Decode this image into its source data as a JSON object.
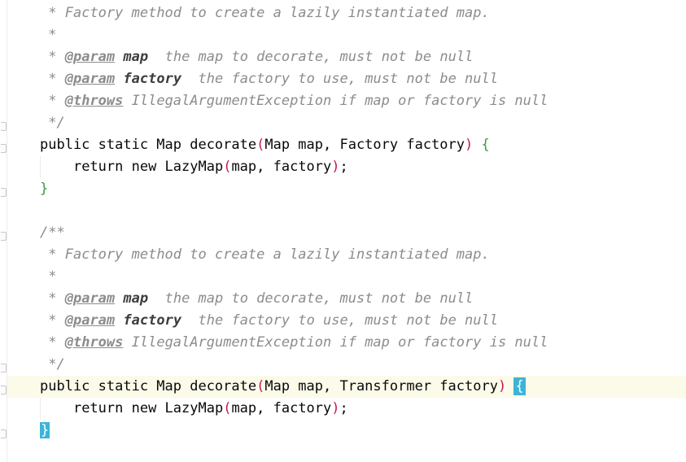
{
  "editor": {
    "lines": [
      {
        "id": "l1",
        "indent": " ",
        "parts": [
          {
            "t": "* ",
            "c": "doc"
          },
          {
            "t": "Factory method to create a lazily instantiated map.",
            "c": "doc"
          }
        ]
      },
      {
        "id": "l2",
        "indent": " ",
        "parts": [
          {
            "t": "*",
            "c": "doc"
          }
        ]
      },
      {
        "id": "l3",
        "indent": " ",
        "parts": [
          {
            "t": "* ",
            "c": "doc"
          },
          {
            "t": "@param",
            "c": "doc-tag"
          },
          {
            "t": " ",
            "c": "doc"
          },
          {
            "t": "map",
            "c": "doc-param"
          },
          {
            "t": "  the map to decorate, must not be null",
            "c": "doc"
          }
        ]
      },
      {
        "id": "l4",
        "indent": " ",
        "parts": [
          {
            "t": "* ",
            "c": "doc"
          },
          {
            "t": "@param",
            "c": "doc-tag"
          },
          {
            "t": " ",
            "c": "doc"
          },
          {
            "t": "factory",
            "c": "doc-param"
          },
          {
            "t": "  the factory to use, must not be null",
            "c": "doc"
          }
        ]
      },
      {
        "id": "l5",
        "indent": " ",
        "parts": [
          {
            "t": "* ",
            "c": "doc"
          },
          {
            "t": "@throws",
            "c": "doc-tag"
          },
          {
            "t": " IllegalArgumentException if map or factory is null",
            "c": "doc"
          }
        ]
      },
      {
        "id": "l6",
        "indent": " ",
        "parts": [
          {
            "t": "*/",
            "c": "doc"
          }
        ]
      },
      {
        "id": "l7",
        "indent": "",
        "parts": [
          {
            "t": "public static Map decorate",
            "c": "plain"
          },
          {
            "t": "(",
            "c": "paren-pink"
          },
          {
            "t": "Map map, Factory factory",
            "c": "plain"
          },
          {
            "t": ")",
            "c": "paren-pink"
          },
          {
            "t": " ",
            "c": "plain"
          },
          {
            "t": "{",
            "c": "brace-green"
          }
        ]
      },
      {
        "id": "l8",
        "indent": "    ",
        "parts": [
          {
            "t": "return new LazyMap",
            "c": "plain"
          },
          {
            "t": "(",
            "c": "paren-pink"
          },
          {
            "t": "map, factory",
            "c": "plain"
          },
          {
            "t": ")",
            "c": "paren-pink"
          },
          {
            "t": ";",
            "c": "plain"
          }
        ]
      },
      {
        "id": "l9",
        "indent": "",
        "parts": [
          {
            "t": "}",
            "c": "brace-green"
          }
        ]
      },
      {
        "id": "l10",
        "indent": "",
        "parts": []
      },
      {
        "id": "l11",
        "indent": "",
        "parts": [
          {
            "t": "/**",
            "c": "doc"
          }
        ]
      },
      {
        "id": "l12",
        "indent": " ",
        "parts": [
          {
            "t": "* ",
            "c": "doc"
          },
          {
            "t": "Factory method to create a lazily instantiated map.",
            "c": "doc"
          }
        ]
      },
      {
        "id": "l13",
        "indent": " ",
        "parts": [
          {
            "t": "*",
            "c": "doc"
          }
        ]
      },
      {
        "id": "l14",
        "indent": " ",
        "parts": [
          {
            "t": "* ",
            "c": "doc"
          },
          {
            "t": "@param",
            "c": "doc-tag"
          },
          {
            "t": " ",
            "c": "doc"
          },
          {
            "t": "map",
            "c": "doc-param"
          },
          {
            "t": "  the map to decorate, must not be null",
            "c": "doc"
          }
        ]
      },
      {
        "id": "l15",
        "indent": " ",
        "parts": [
          {
            "t": "* ",
            "c": "doc"
          },
          {
            "t": "@param",
            "c": "doc-tag"
          },
          {
            "t": " ",
            "c": "doc"
          },
          {
            "t": "factory",
            "c": "doc-param"
          },
          {
            "t": "  the factory to use, must not be null",
            "c": "doc"
          }
        ]
      },
      {
        "id": "l16",
        "indent": " ",
        "parts": [
          {
            "t": "* ",
            "c": "doc"
          },
          {
            "t": "@throws",
            "c": "doc-tag"
          },
          {
            "t": " IllegalArgumentException if map or factory is null",
            "c": "doc"
          }
        ]
      },
      {
        "id": "l17",
        "indent": " ",
        "parts": [
          {
            "t": "*/",
            "c": "doc"
          }
        ]
      },
      {
        "id": "l18",
        "indent": "",
        "current": true,
        "parts": [
          {
            "t": "public static Map decorate",
            "c": "plain"
          },
          {
            "t": "(",
            "c": "paren-pink"
          },
          {
            "t": "Map map, Transformer factory",
            "c": "plain"
          },
          {
            "t": ")",
            "c": "paren-pink"
          },
          {
            "t": " ",
            "c": "plain"
          },
          {
            "t": "{",
            "c": "cursor-brace outline"
          }
        ]
      },
      {
        "id": "l19",
        "indent": "    ",
        "parts": [
          {
            "t": "return new LazyMap",
            "c": "plain"
          },
          {
            "t": "(",
            "c": "paren-pink"
          },
          {
            "t": "map, factory",
            "c": "plain"
          },
          {
            "t": ")",
            "c": "paren-pink"
          },
          {
            "t": ";",
            "c": "plain"
          }
        ]
      },
      {
        "id": "l20",
        "indent": "",
        "parts": [
          {
            "t": "}",
            "c": "cursor-brace"
          }
        ]
      }
    ]
  }
}
